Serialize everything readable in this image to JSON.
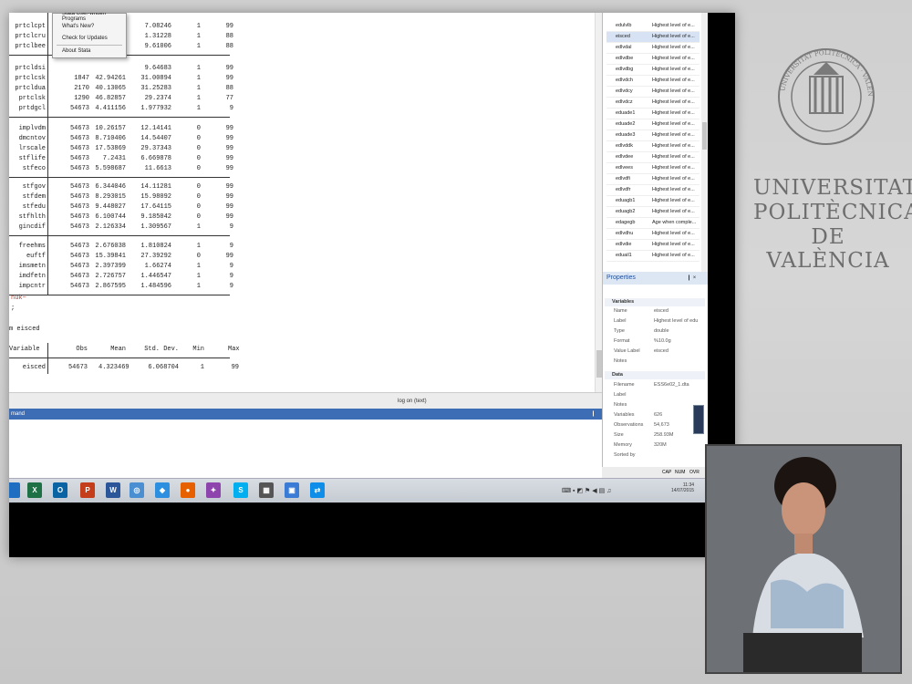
{
  "help_menu": {
    "items": [
      "Stata User-written Programs",
      "What's New?",
      "Check for Updates",
      "About Stata"
    ]
  },
  "results": {
    "groups": [
      {
        "rows": [
          [
            "prtclcpt",
            "",
            "",
            "7.08246",
            "1",
            "99"
          ],
          [
            "prtclcru",
            "",
            "",
            "1.31228",
            "1",
            "88"
          ],
          [
            "prtclbee",
            "",
            "",
            "9.61006",
            "1",
            "88"
          ]
        ]
      },
      {
        "rows": [
          [
            "prtcldsi",
            "",
            "",
            "9.64683",
            "1",
            "99"
          ],
          [
            "prtclcsk",
            "1847",
            "42.94261",
            "31.00894",
            "1",
            "99"
          ],
          [
            "prtcldua",
            "2170",
            "40.13065",
            "31.25283",
            "1",
            "88"
          ],
          [
            "prtclsk",
            "1290",
            "46.82857",
            "29.2374",
            "1",
            "77"
          ],
          [
            "prtdgcl",
            "54673",
            "4.411156",
            "1.977932",
            "1",
            "9"
          ]
        ]
      },
      {
        "rows": [
          [
            "implvdm",
            "54673",
            "10.26157",
            "12.14141",
            "0",
            "99"
          ],
          [
            "dmcntov",
            "54673",
            "8.710406",
            "14.54407",
            "0",
            "99"
          ],
          [
            "lrscale",
            "54673",
            "17.53869",
            "29.37343",
            "0",
            "99"
          ],
          [
            "stflife",
            "54673",
            "7.2431",
            "6.669878",
            "0",
            "99"
          ],
          [
            "stfeco",
            "54673",
            "5.598687",
            "11.6613",
            "0",
            "99"
          ]
        ]
      },
      {
        "rows": [
          [
            "stfgov",
            "54673",
            "6.344046",
            "14.11281",
            "0",
            "99"
          ],
          [
            "stfdem",
            "54673",
            "8.293015",
            "15.98092",
            "0",
            "99"
          ],
          [
            "stfedu",
            "54673",
            "9.448027",
            "17.64115",
            "0",
            "99"
          ],
          [
            "stfhlth",
            "54673",
            "6.100744",
            "9.185042",
            "0",
            "99"
          ],
          [
            "gincdif",
            "54673",
            "2.126334",
            "1.309567",
            "1",
            "9"
          ]
        ]
      },
      {
        "rows": [
          [
            "freehms",
            "54673",
            "2.676038",
            "1.810824",
            "1",
            "9"
          ],
          [
            "euftf",
            "54673",
            "15.39841",
            "27.39292",
            "0",
            "99"
          ],
          [
            "imsmetn",
            "54673",
            "2.397399",
            "1.66274",
            "1",
            "9"
          ],
          [
            "imdfetn",
            "54673",
            "2.726757",
            "1.446547",
            "1",
            "9"
          ],
          [
            "impcntr",
            "54673",
            "2.867595",
            "1.484596",
            "1",
            "9"
          ]
        ]
      }
    ],
    "error_line": "nuk~",
    "semicolon": ";",
    "command": "m eisced",
    "header": [
      "Variable",
      "Obs",
      "Mean",
      "Std. Dev.",
      "Min",
      "Max"
    ],
    "eisced_row": [
      "eisced",
      "54673",
      "4.323469",
      "6.068704",
      "1",
      "99"
    ],
    "log_status": "log on (text)",
    "command_pane_title": "mand",
    "command_pane_pin": "❙"
  },
  "variables": {
    "rows": [
      {
        "name": "edulvlb",
        "label": "Highest level of e..."
      },
      {
        "name": "eisced",
        "label": "Highest level of e..."
      },
      {
        "name": "edlvdal",
        "label": "Highest level of e..."
      },
      {
        "name": "edlvdbe",
        "label": "Highest level of e..."
      },
      {
        "name": "edlvdbg",
        "label": "Highest level of e..."
      },
      {
        "name": "edlvdch",
        "label": "Highest level of e..."
      },
      {
        "name": "edlvdcy",
        "label": "Highest level of e..."
      },
      {
        "name": "edlvdcz",
        "label": "Highest level of e..."
      },
      {
        "name": "eduade1",
        "label": "Highest level of e..."
      },
      {
        "name": "eduade2",
        "label": "Highest level of e..."
      },
      {
        "name": "eduade3",
        "label": "Highest level of e..."
      },
      {
        "name": "edlvddk",
        "label": "Highest level of e..."
      },
      {
        "name": "edlvdee",
        "label": "Highest level of e..."
      },
      {
        "name": "edlvees",
        "label": "Highest level of e..."
      },
      {
        "name": "edlvdfi",
        "label": "Highest level of e..."
      },
      {
        "name": "edlvdfr",
        "label": "Highest level of e..."
      },
      {
        "name": "eduagb1",
        "label": "Highest level of e..."
      },
      {
        "name": "eduagb2",
        "label": "Highest level of e..."
      },
      {
        "name": "edagegb",
        "label": "Age when comple..."
      },
      {
        "name": "edlvdhu",
        "label": "Highest level of e..."
      },
      {
        "name": "edlvdie",
        "label": "Highest level of e..."
      },
      {
        "name": "eduail1",
        "label": "Highest level of e..."
      }
    ]
  },
  "properties": {
    "title": "Properties",
    "pin": "❙ ×",
    "variables_section": "Variables",
    "variables": [
      [
        "Name",
        "eisced"
      ],
      [
        "Label",
        "Highest level of edu"
      ],
      [
        "Type",
        "double"
      ],
      [
        "Format",
        "%10.0g"
      ],
      [
        "Value Label",
        "eisced"
      ],
      [
        "Notes",
        ""
      ]
    ],
    "data_section": "Data",
    "data": [
      [
        "Filename",
        "ESS6e02_1.dta"
      ],
      [
        "Label",
        ""
      ],
      [
        "Notes",
        ""
      ],
      [
        "Variables",
        "626"
      ],
      [
        "Observations",
        "54,673"
      ],
      [
        "Size",
        "258.93M"
      ],
      [
        "Memory",
        "320M"
      ],
      [
        "Sorted by",
        ""
      ]
    ]
  },
  "app_status": [
    "CAP",
    "NUM",
    "OVR"
  ],
  "taskbar": {
    "time": "11:34",
    "date": "14/07/2015",
    "icons": [
      {
        "name": "start-icon",
        "glyph": "",
        "color": "#1e6fc2"
      },
      {
        "name": "excel-icon",
        "glyph": "X",
        "color": "#1e7145"
      },
      {
        "name": "outlook-icon",
        "glyph": "O",
        "color": "#0a64a4"
      },
      {
        "name": "powerpoint-icon",
        "glyph": "P",
        "color": "#c43e1c"
      },
      {
        "name": "word-icon",
        "glyph": "W",
        "color": "#2b579a"
      },
      {
        "name": "network-icon",
        "glyph": "◎",
        "color": "#4a8fd1"
      },
      {
        "name": "dropbox-icon",
        "glyph": "◆",
        "color": "#2c8fe0"
      },
      {
        "name": "firefox-icon",
        "glyph": "●",
        "color": "#e66000"
      },
      {
        "name": "tool-icon",
        "glyph": "✦",
        "color": "#8e44ad"
      },
      {
        "name": "skype-icon",
        "glyph": "S",
        "color": "#00aff0"
      },
      {
        "name": "grid-app-icon",
        "glyph": "▦",
        "color": "#555"
      },
      {
        "name": "monitor-icon",
        "glyph": "▣",
        "color": "#3a7bd5"
      },
      {
        "name": "teamviewer-icon",
        "glyph": "⇄",
        "color": "#0e8ee9"
      }
    ]
  },
  "logo": {
    "line1": "UNIVERSITAT",
    "line2": "POLITÈCNICA",
    "line3": "DE VALÈNCIA",
    "seal_text": "UNIVERSITAT POLITÈCNICA · VALÈNCIA ·"
  }
}
